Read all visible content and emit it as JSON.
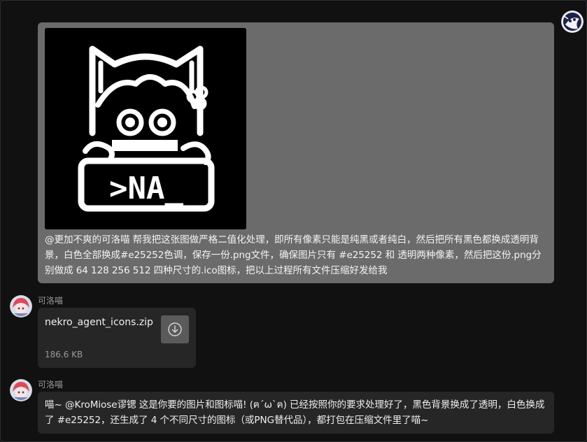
{
  "user_message": {
    "image_caption": ">NA_",
    "text": "@更加不爽的可洛喵 帮我把这张图做严格二值化处理，即所有像素只能是纯黑或者纯白，然后把所有黑色都换成透明背景，白色全部换成#e25252色调，保存一份.png文件，确保图片只有 #e25252 和 透明两种像素，然后把这份.png分别做成 64 128 256 512 四种尺寸的.ico图标，把以上过程所有文件压缩好发给我"
  },
  "bot_file_message": {
    "sender": "可洛喵",
    "file_name": "nekro_agent_icons.zip",
    "file_size": "186.6 KB",
    "download_icon": "download-icon"
  },
  "bot_text_message": {
    "sender": "可洛喵",
    "text": "喵~ @KroMiose谬锶 这是你要的图片和图标喵! (ฅ´ω`ฅ) 已经按照你的要求处理好了，黑色背景换成了透明，白色换成了 #e25252，还生成了 4 个不同尺寸的图标（或PNG替代品），都打包在压缩文件里了喵~"
  },
  "colors": {
    "background": "#111111",
    "user_bubble": "#6b6b6b",
    "bot_bubble": "#262626",
    "accent": "#e25252"
  }
}
